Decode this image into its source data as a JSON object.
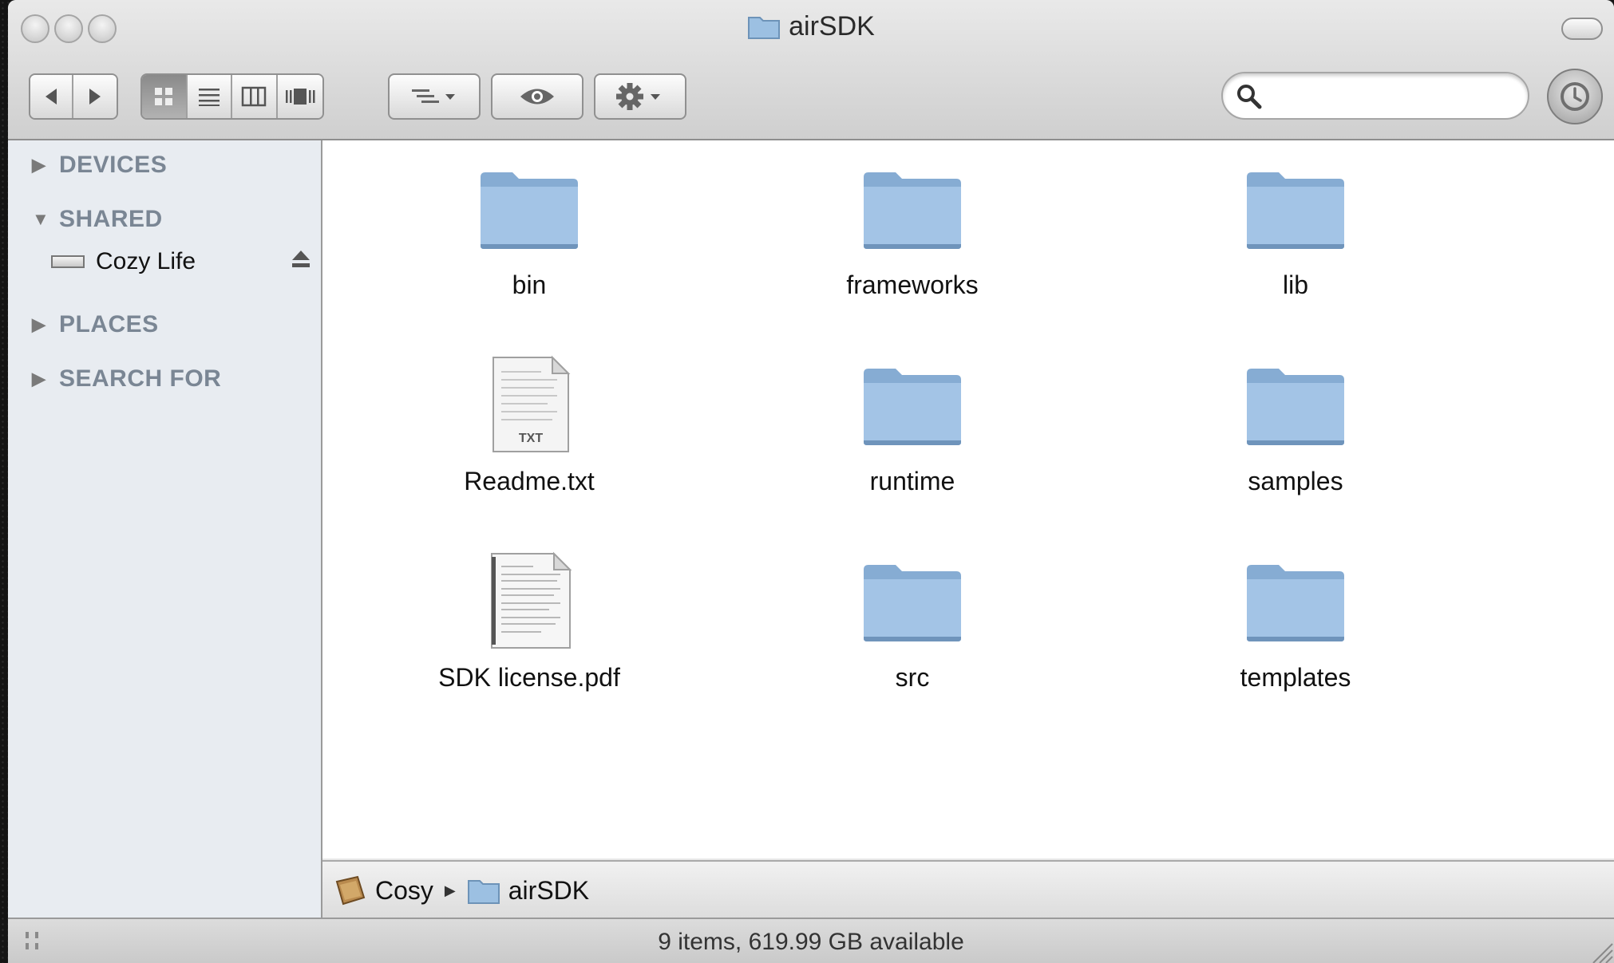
{
  "window": {
    "title": "airSDK"
  },
  "toolbar": {
    "search": {
      "placeholder": "",
      "value": ""
    },
    "view_modes": [
      "icon-view",
      "list-view",
      "column-view",
      "cover-flow"
    ],
    "active_view": "icon-view"
  },
  "sidebar": {
    "sections": [
      {
        "label": "DEVICES",
        "expanded": false
      },
      {
        "label": "SHARED",
        "expanded": true,
        "items": [
          {
            "label": "Cozy Life",
            "icon": "network-drive-icon",
            "ejectable": true
          }
        ]
      },
      {
        "label": "PLACES",
        "expanded": false
      },
      {
        "label": "SEARCH FOR",
        "expanded": false
      }
    ]
  },
  "items": [
    {
      "name": "bin",
      "kind": "folder"
    },
    {
      "name": "frameworks",
      "kind": "folder"
    },
    {
      "name": "lib",
      "kind": "folder"
    },
    {
      "name": "Readme.txt",
      "kind": "text"
    },
    {
      "name": "runtime",
      "kind": "folder"
    },
    {
      "name": "samples",
      "kind": "folder"
    },
    {
      "name": "SDK license.pdf",
      "kind": "pdf"
    },
    {
      "name": "src",
      "kind": "folder"
    },
    {
      "name": "templates",
      "kind": "folder"
    }
  ],
  "txt_badge": "TXT",
  "pathbar": {
    "segments": [
      "Cosy",
      "airSDK"
    ]
  },
  "status": {
    "text": "9 items, 619.99 GB available"
  },
  "colors": {
    "folder": "#8fb4d8",
    "sidebar": "#e8ecf1",
    "section_header": "#7a8694"
  }
}
